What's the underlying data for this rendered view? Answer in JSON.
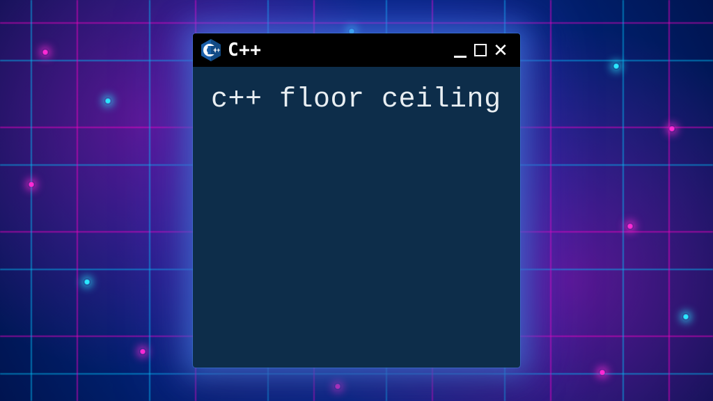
{
  "window": {
    "title": "C++",
    "content": "c++ floor ceiling"
  },
  "colors": {
    "terminal_bg": "#0d2d4a",
    "titlebar_bg": "#000000",
    "text": "#e8eef2",
    "glow_cyan": "#2ae8ff",
    "glow_magenta": "#ff2ad4",
    "logo_blue": "#1b5fa8"
  }
}
